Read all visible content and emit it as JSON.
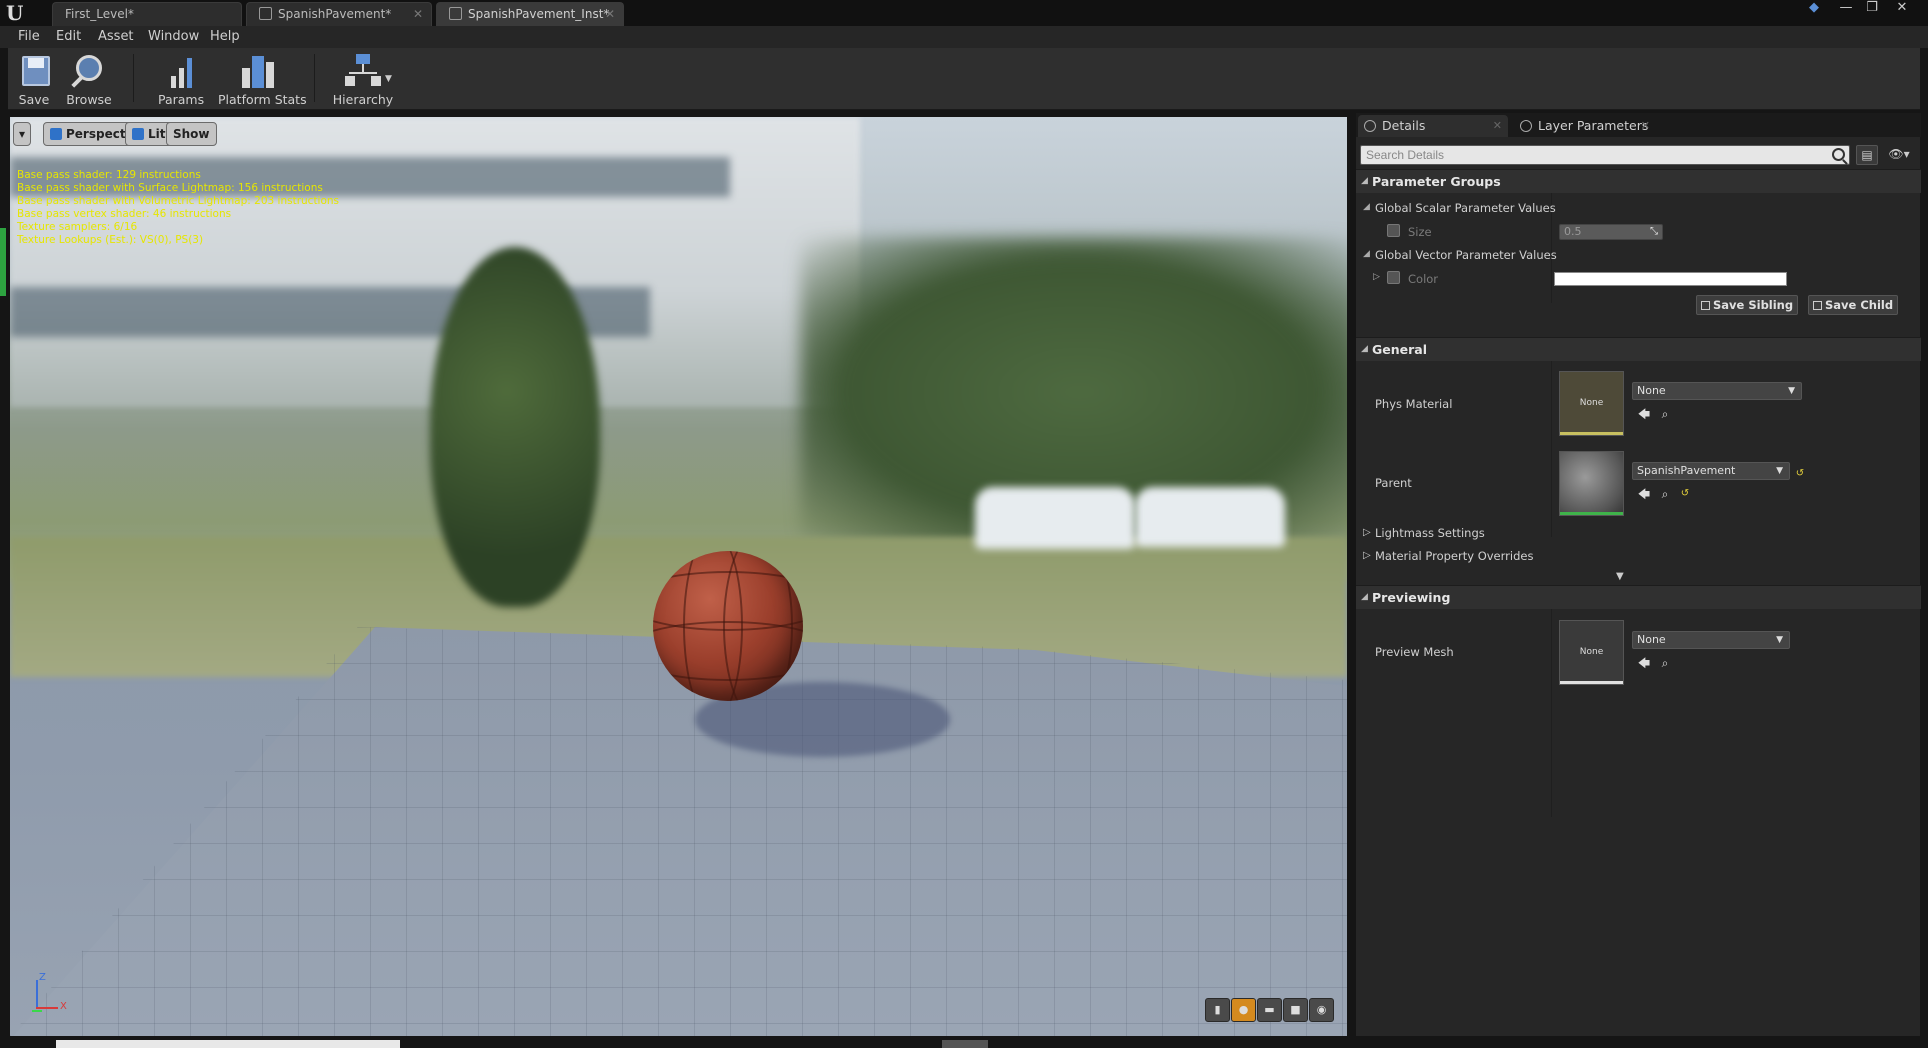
{
  "app": {
    "tabs": [
      {
        "label": "First_Level*"
      },
      {
        "label": "SpanishPavement*"
      },
      {
        "label": "SpanishPavement_Inst*"
      }
    ]
  },
  "menu": {
    "items": [
      "File",
      "Edit",
      "Asset",
      "Window",
      "Help"
    ]
  },
  "toolbar": {
    "save": "Save",
    "browse": "Browse",
    "params": "Params",
    "platform_stats": "Platform Stats",
    "hierarchy": "Hierarchy"
  },
  "viewport": {
    "perspective": "Perspective",
    "lit": "Lit",
    "show": "Show",
    "stats": [
      "Base pass shader: 129 instructions",
      "Base pass shader with Surface Lightmap: 156 instructions",
      "Base pass shader with Volumetric Lightmap: 203 instructions",
      "Base pass vertex shader: 46 instructions",
      "Texture samplers: 6/16",
      "Texture Lookups (Est.): VS(0), PS(3)"
    ],
    "axis": {
      "z": "Z",
      "x": "X"
    }
  },
  "details": {
    "tabs": {
      "details": "Details",
      "layer_parameters": "Layer Parameters"
    },
    "search_placeholder": "Search Details",
    "parameter_groups": {
      "title": "Parameter Groups",
      "scalar_group": "Global Scalar Parameter Values",
      "size_label": "Size",
      "size_value": "0.5",
      "vector_group": "Global Vector Parameter Values",
      "color_label": "Color",
      "color_value": "#ffffff",
      "save_sibling": "Save Sibling",
      "save_child": "Save Child"
    },
    "general": {
      "title": "General",
      "phys_material_label": "Phys Material",
      "phys_material_value": "None",
      "phys_material_thumb": "None",
      "parent_label": "Parent",
      "parent_value": "SpanishPavement",
      "lightmass_settings": "Lightmass Settings",
      "material_property_overrides": "Material Property Overrides"
    },
    "previewing": {
      "title": "Previewing",
      "preview_mesh_label": "Preview Mesh",
      "preview_mesh_value": "None",
      "preview_mesh_thumb": "None"
    }
  },
  "colors": {
    "accent_green": "#2da340",
    "stats_yellow": "#e6e600",
    "active_view_mode": "#d48a1f"
  }
}
